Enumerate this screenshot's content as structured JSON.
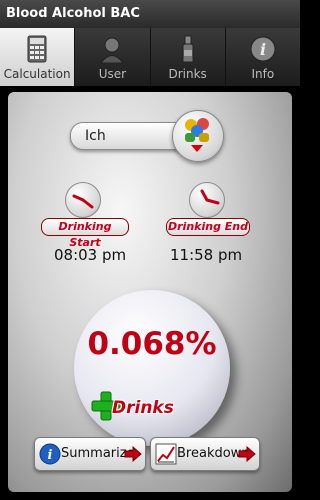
{
  "app": {
    "title": "Blood Alcohol BAC"
  },
  "tabs": [
    {
      "label": "Calculation",
      "icon": "calculator-icon",
      "active": true
    },
    {
      "label": "User",
      "icon": "user-icon",
      "active": false
    },
    {
      "label": "Drinks",
      "icon": "bottle-icon",
      "active": false
    },
    {
      "label": "Info",
      "icon": "info-icon",
      "active": false
    }
  ],
  "user": {
    "selected": "Ich",
    "icon": "user-group-icon"
  },
  "drinking_start": {
    "label": "Drinking Start",
    "time": "08:03 pm",
    "icon": "clock-icon"
  },
  "drinking_end": {
    "label": "Drinking End",
    "time": "11:58 pm",
    "icon": "clock-icon"
  },
  "bac": {
    "value": "0.068%"
  },
  "drinks_button": {
    "label": "Drinks",
    "icon": "plus-icon"
  },
  "buttons": {
    "summarize": {
      "label": "Summarize",
      "icon": "info-icon"
    },
    "breakdown": {
      "label": "Breakdown",
      "icon": "chart-icon"
    }
  },
  "colors": {
    "accent_red": "#c00015",
    "plus_green": "#1fb01f"
  }
}
